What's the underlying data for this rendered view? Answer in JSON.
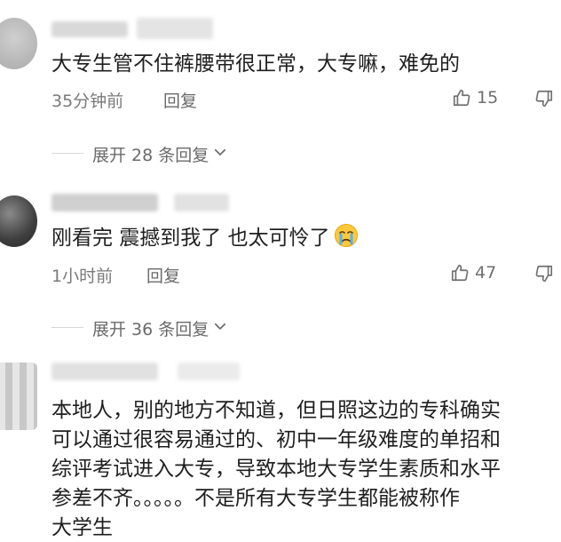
{
  "comments": [
    {
      "text": "大专生管不住裤腰带很正常，大专嘛，难免的",
      "time": "35分钟前",
      "reply_label": "回复",
      "likes": "15",
      "expand_label": "展开 28 条回复"
    },
    {
      "text": "刚看完 震撼到我了  也太可怜了",
      "emoji": "crying-face-emoji",
      "time": "1小时前",
      "reply_label": "回复",
      "likes": "47",
      "expand_label": "展开 36 条回复"
    },
    {
      "lines": [
        "本地人，别的地方不知道，但日照这边的专科确实",
        "可以通过很容易通过的、初中一年级难度的单招和",
        "综评考试进入大专，导致本地大专学生素质和水平",
        "参差不齐。。。。。不是所有大专学生都能被称作",
        "大学生"
      ]
    }
  ],
  "colors": {
    "text": "#1f1f1f",
    "meta": "#7a7a7a",
    "divider": "#d6d6d6"
  }
}
